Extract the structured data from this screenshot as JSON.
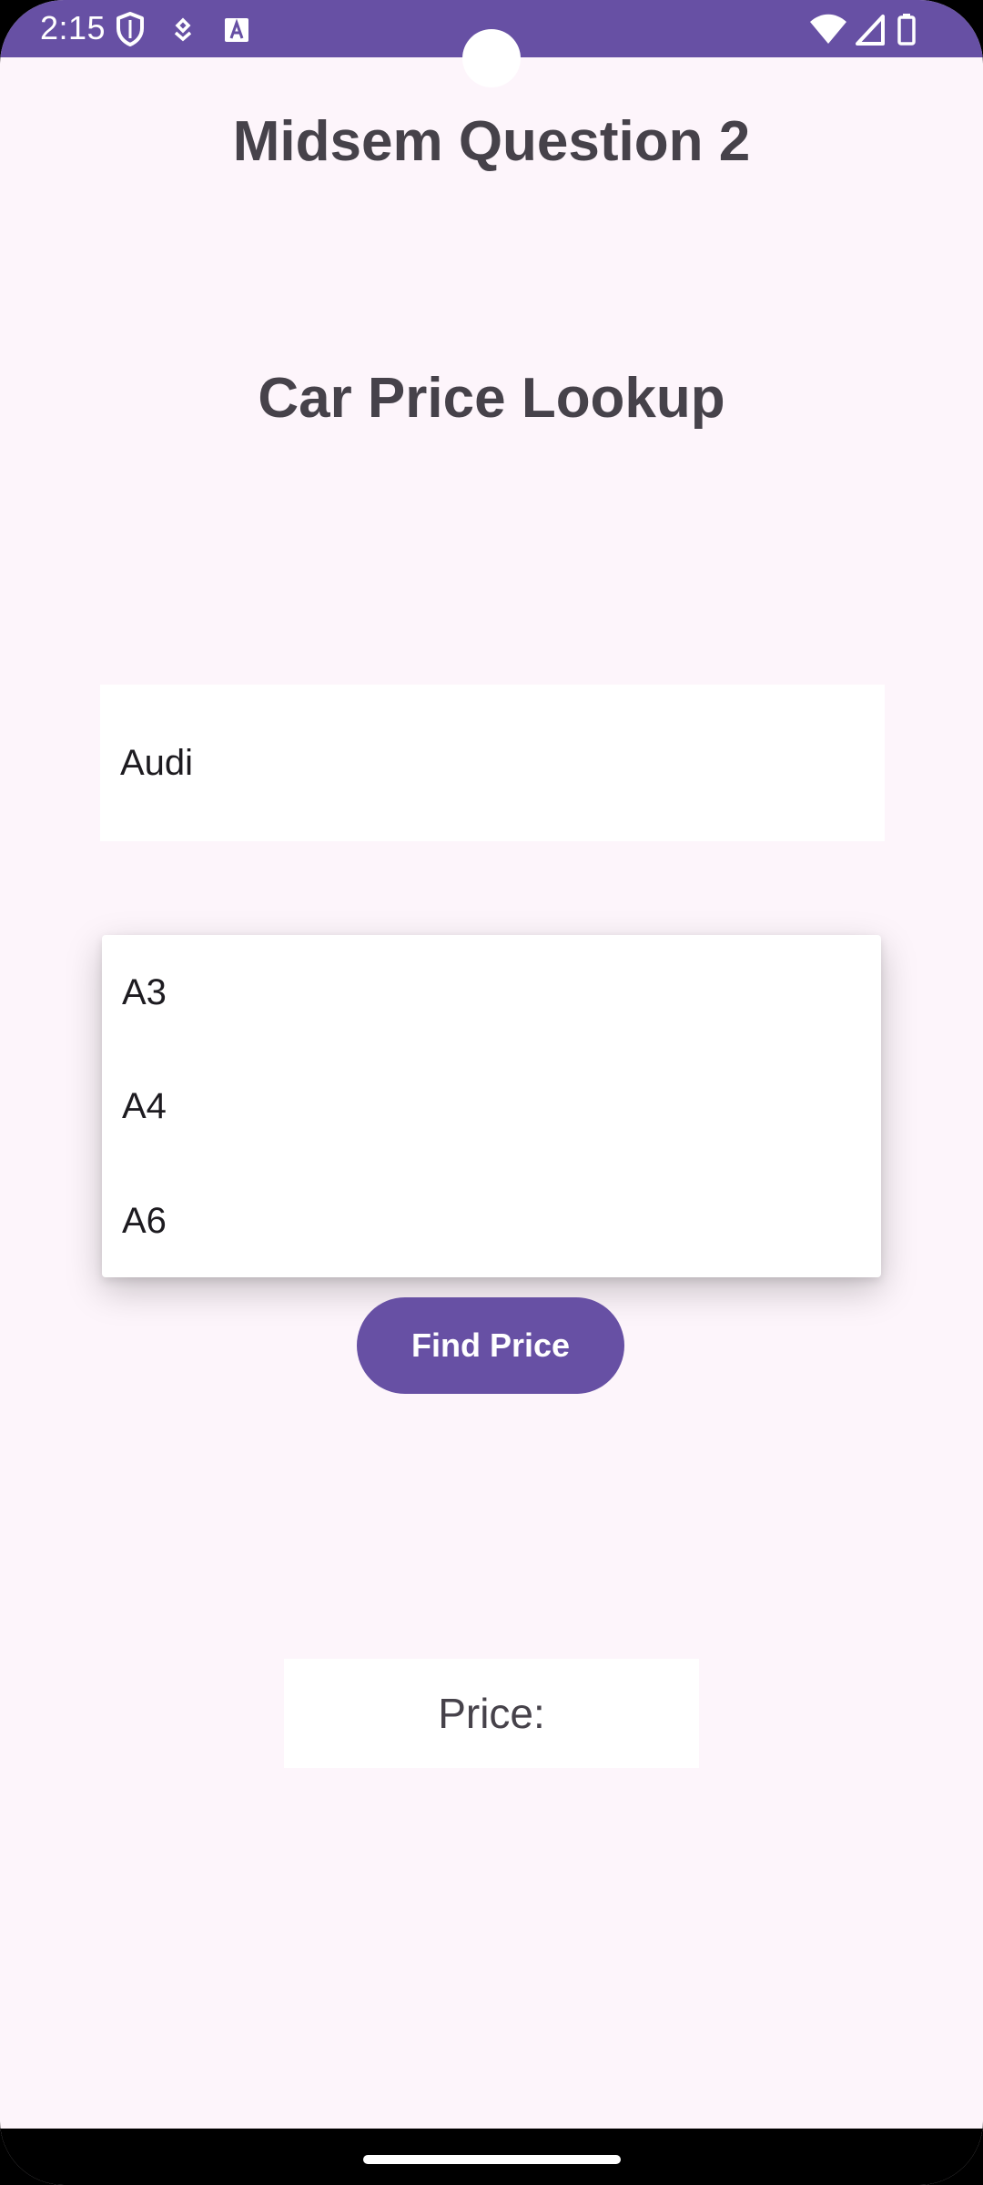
{
  "status_bar": {
    "time": "2:15",
    "icons": [
      "shield-icon",
      "assistant-icon",
      "keyboard-a-icon",
      "wifi-icon",
      "signal-icon",
      "battery-icon"
    ],
    "color": "#6750a4"
  },
  "app": {
    "title": "Midsem Question 2",
    "section_title": "Car Price Lookup"
  },
  "make_field": {
    "value": "Audi"
  },
  "model_dropdown": {
    "options": [
      "A3",
      "A4",
      "A6"
    ]
  },
  "find_button": {
    "label": "Find Price",
    "color": "#6750a4"
  },
  "price": {
    "label": "Price:"
  }
}
